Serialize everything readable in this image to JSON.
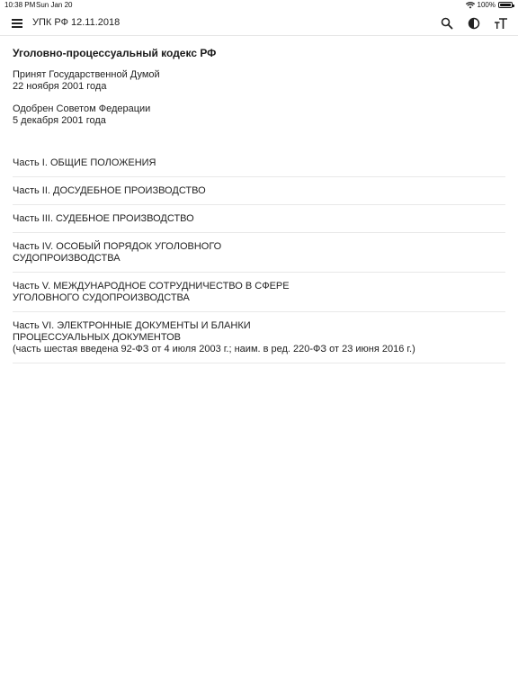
{
  "status": {
    "time": "10:38 PM",
    "date": "Sun Jan 20",
    "battery": "100%"
  },
  "app_bar": {
    "title": "УПК РФ 12.11.2018",
    "icons": [
      "menu-icon",
      "search-icon",
      "contrast-icon",
      "text-size-icon"
    ]
  },
  "document": {
    "title": "Уголовно-процессуальный кодекс РФ",
    "adopted_line1": "Принят Государственной Думой",
    "adopted_line2": "22 ноября 2001 года",
    "approved_line1": "Одобрен Советом Федерации",
    "approved_line2": "5 декабря 2001 года"
  },
  "parts": [
    {
      "lines": [
        "Часть I. ОБЩИЕ ПОЛОЖЕНИЯ"
      ]
    },
    {
      "lines": [
        "Часть II. ДОСУДЕБНОЕ ПРОИЗВОДСТВО"
      ]
    },
    {
      "lines": [
        "Часть III. СУДЕБНОЕ ПРОИЗВОДСТВО"
      ]
    },
    {
      "lines": [
        "Часть IV. ОСОБЫЙ ПОРЯДОК УГОЛОВНОГО",
        "СУДОПРОИЗВОДСТВА"
      ]
    },
    {
      "lines": [
        "Часть V. МЕЖДУНАРОДНОЕ СОТРУДНИЧЕСТВО В СФЕРЕ",
        "УГОЛОВНОГО СУДОПРОИЗВОДСТВА"
      ]
    },
    {
      "lines": [
        "Часть VI. ЭЛЕКТРОННЫЕ ДОКУМЕНТЫ И БЛАНКИ",
        "ПРОЦЕССУАЛЬНЫХ ДОКУМЕНТОВ",
        "(часть шестая введена 92-ФЗ от 4 июля 2003 г.; наим. в ред. 220-ФЗ от 23 июня 2016 г.)"
      ]
    }
  ]
}
